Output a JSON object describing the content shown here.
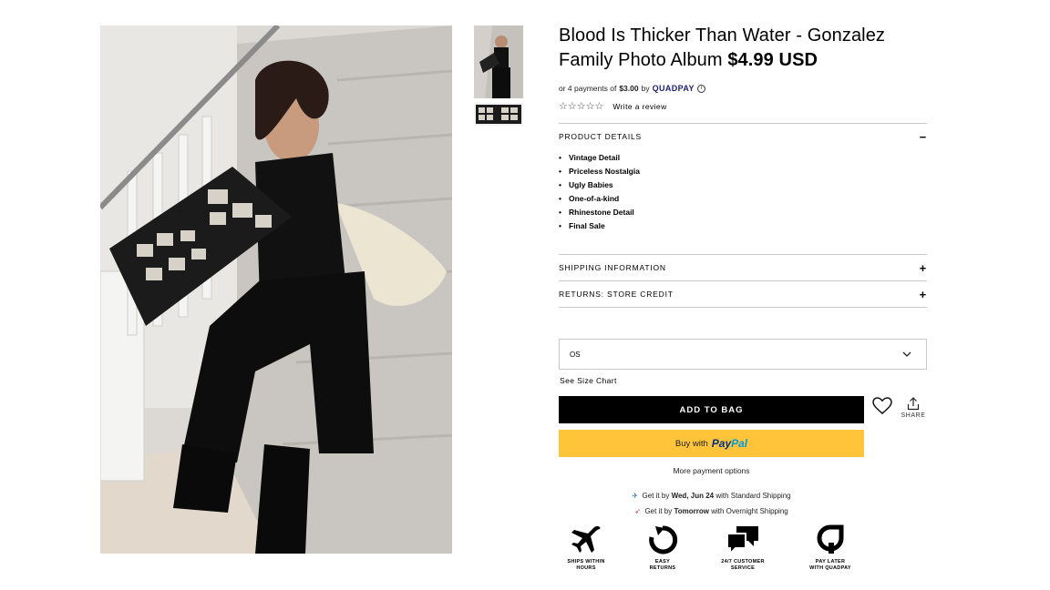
{
  "product": {
    "title": "Blood Is Thicker Than Water - Gonzalez Family Photo Album",
    "price": "$4.99 USD"
  },
  "installments": {
    "prefix": "or 4 payments of",
    "amount": "$3.00",
    "by": "by",
    "provider": "QUADPAY"
  },
  "rating": {
    "stars": "☆☆☆☆☆",
    "write_review": "Write a review"
  },
  "sections": {
    "details": {
      "label": "PRODUCT DETAILS",
      "sign": "−",
      "items": [
        "Vintage Detail",
        "Priceless Nostalgia",
        "Ugly Babies",
        "One-of-a-kind",
        "Rhinestone Detail",
        "Final Sale"
      ]
    },
    "shipping": {
      "label": "SHIPPING INFORMATION",
      "sign": "+"
    },
    "returns": {
      "label": "RETURNS: STORE CREDIT",
      "sign": "+"
    }
  },
  "size": {
    "value": "OS",
    "chart_link": "See Size Chart"
  },
  "actions": {
    "add_to_bag": "ADD TO BAG",
    "share": "SHARE",
    "paypal_prefix": "Buy with",
    "paypal_brand_1": "Pay",
    "paypal_brand_2": "Pal",
    "more_payment": "More payment options"
  },
  "shipping_estimates": [
    {
      "prefix": "Get it by",
      "date": "Wed, Jun 24",
      "suffix": "with Standard Shipping"
    },
    {
      "prefix": "Get it by",
      "date": "Tomorrow",
      "suffix": "with Overnight Shipping"
    }
  ],
  "badges": [
    {
      "icon": "airplane-icon",
      "label_1": "SHIPS WITHIN",
      "label_2": "HOURS"
    },
    {
      "icon": "return-arrow-icon",
      "label_1": "EASY",
      "label_2": "RETURNS"
    },
    {
      "icon": "chat-bubbles-icon",
      "label_1": "24/7 CUSTOMER",
      "label_2": "SERVICE"
    },
    {
      "icon": "quadpay-icon",
      "label_1": "PAY LATER",
      "label_2": "WITH QUADPAY"
    }
  ]
}
